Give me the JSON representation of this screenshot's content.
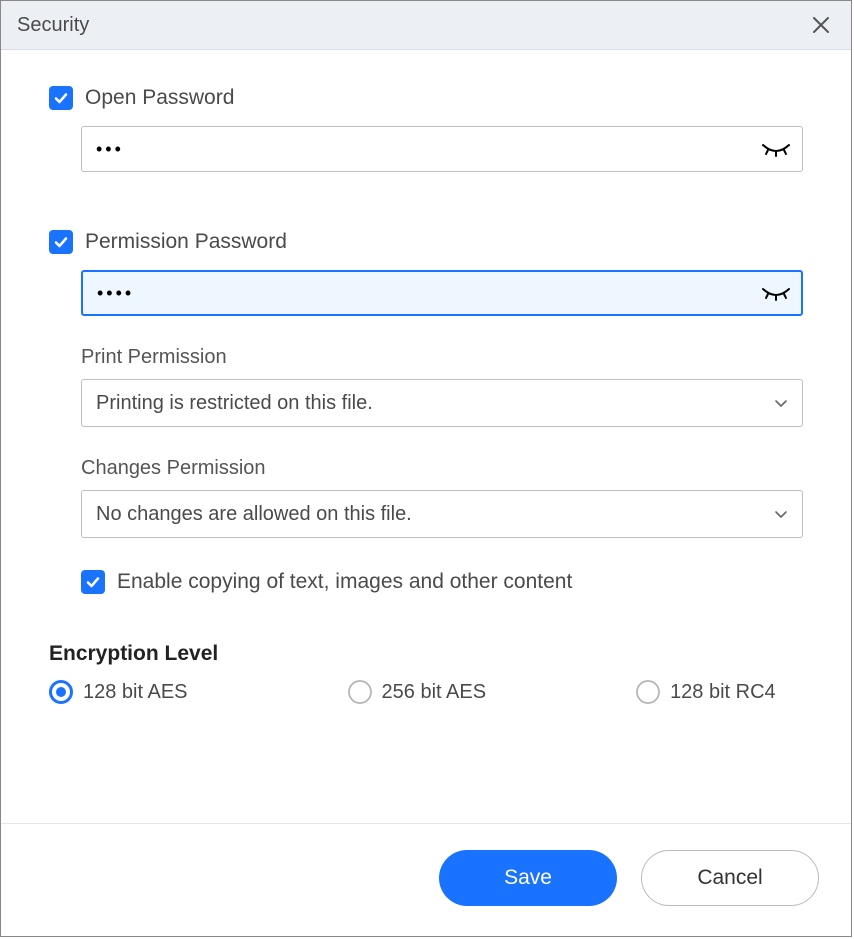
{
  "dialog": {
    "title": "Security"
  },
  "openPassword": {
    "label": "Open Password",
    "checked": true,
    "value": "•••"
  },
  "permissionPassword": {
    "label": "Permission Password",
    "checked": true,
    "value": "••••"
  },
  "printPermission": {
    "label": "Print Permission",
    "value": "Printing is restricted on this file."
  },
  "changesPermission": {
    "label": "Changes Permission",
    "value": "No changes are allowed on this file."
  },
  "enableCopy": {
    "label": "Enable copying of text, images and other content",
    "checked": true
  },
  "encryption": {
    "title": "Encryption Level",
    "options": {
      "a": "128 bit AES",
      "b": "256 bit AES",
      "c": "128 bit RC4"
    },
    "selected": "a"
  },
  "buttons": {
    "save": "Save",
    "cancel": "Cancel"
  }
}
